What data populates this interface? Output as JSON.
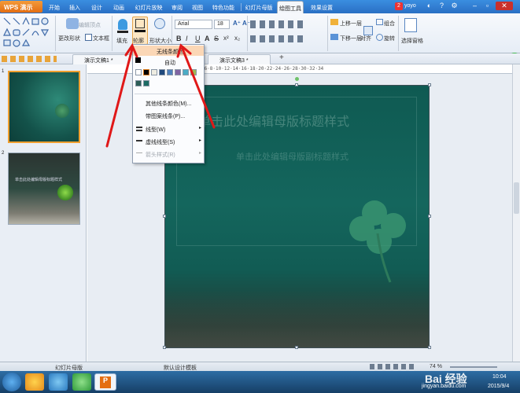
{
  "titlebar": {
    "app_button": "WPS 演示",
    "menu_tabs": [
      "开始",
      "插入",
      "设计",
      "动画",
      "幻灯片放映",
      "审阅",
      "视图",
      "特色功能",
      "幻灯片母版",
      "绘图工具",
      "效果设置"
    ],
    "active_tab": "绘图工具",
    "user_label": "yoyo",
    "notify_count": "2"
  },
  "ribbon": {
    "left_buttons": [
      "编辑顶点",
      "更改形状",
      "文本框"
    ],
    "fill_label": "填充",
    "outline_label": "轮廓",
    "shape_size_label": "形状大小",
    "font_name": "Arial",
    "font_size": "18",
    "up_layer": "上移一层",
    "down_layer": "下移一层",
    "group": "组合",
    "align": "对齐",
    "rotate": "旋转",
    "select_pane": "选择窗格"
  },
  "doc_tabs": [
    "演示文稿1 *",
    "演示文稿3 *"
  ],
  "ruler_marks": "8·6·4·2·0·2·4·6·8·10·12·14·16·18·20·22·24·26·28·30·32·34",
  "thumbnails": [
    {
      "num": "1",
      "text": ""
    },
    {
      "num": "2",
      "text": "单击此处编辑母版标题样式"
    }
  ],
  "slide": {
    "title_placeholder": "单击此处编辑母版标题样式",
    "subtitle_placeholder": "单击此处编辑母版副标题样式"
  },
  "dropdown": {
    "no_line": "无线条颜色",
    "auto": "自动",
    "more_colors": "其他线条颜色(M)...",
    "pattern_line": "带图案线条(P)...",
    "line_type": "线型(W)",
    "dash_type": "虚线线型(S)",
    "arrow_style": "箭头样式(R)",
    "swatch_colors": [
      "#ffffff",
      "#000000",
      "#eeece1",
      "#1f497d",
      "#4f81bd",
      "#c0504d",
      "#9bbb59",
      "#8064a2",
      "#4bacc6",
      "#f79646",
      "#2c5d57",
      "#1d6b64"
    ]
  },
  "statusbar": {
    "left": "幻灯片母版",
    "center": "默认设计模板",
    "zoom": "74 %"
  },
  "taskbar": {
    "time": "10:04",
    "date": "2015/9/4",
    "watermark": "Bai 经验",
    "watermark_url": "jingyan.baidu.com"
  },
  "colors": {
    "accent": "#2a6fc4",
    "app_orange": "#e46e12",
    "slide_teal": "#14665d",
    "annotation_red": "#e01818"
  }
}
